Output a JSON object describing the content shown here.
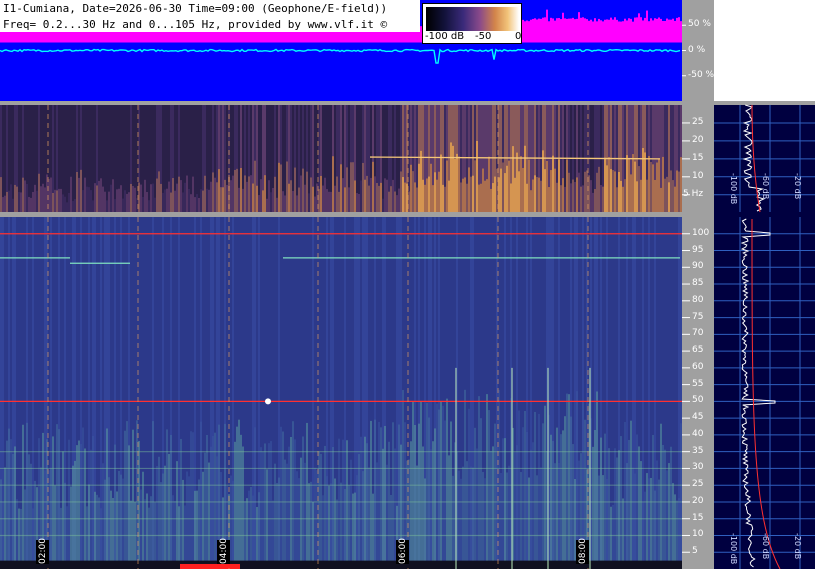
{
  "header": {
    "line1": "I1-Cumiana, Date=2026-06-30 Time=09:00 (Geophone/E-field))",
    "line2": "Freq= 0.2...30 Hz and 0...105 Hz, provided by www.vlf.it ©"
  },
  "colorscale": {
    "label_min": "-100 dB",
    "label_mid": "-50",
    "label_max": "0"
  },
  "colors": {
    "amplitude_bg": "#0000ff",
    "amplitude_envelope": "#ff00ff",
    "amplitude_trace": "#00ffff",
    "spectrum_panel_bg": "#000040",
    "spectrogram_bg": "#2c3a8a",
    "hum_line": "#ff3030",
    "cursor_line": "#e6a060",
    "axis_panel": "#a0a0a0"
  },
  "chart_data": [
    {
      "type": "line",
      "name": "amplitude-panel",
      "y_tick_labels": [
        "50 %",
        "0 %",
        "-50 %"
      ],
      "y_ticks": [
        50,
        0,
        -50
      ],
      "ylim": [
        -100,
        100
      ]
    },
    {
      "type": "heatmap",
      "name": "geophone-spectrogram",
      "y_tick_labels": [
        "25",
        "20",
        "15",
        "10",
        "5 Hz"
      ],
      "y_ticks": [
        25,
        20,
        15,
        10,
        5
      ],
      "ylim": [
        0.2,
        30
      ],
      "spectrum_db_labels": [
        "-100 dB",
        "-60 dB",
        "-20 dB"
      ]
    },
    {
      "type": "heatmap",
      "name": "efield-spectrogram",
      "y_tick_labels": [
        "100",
        "95",
        "90",
        "85",
        "80",
        "75",
        "70",
        "65",
        "60",
        "55",
        "50",
        "45",
        "40",
        "35",
        "30",
        "25",
        "20",
        "15",
        "10",
        "5"
      ],
      "y_ticks": [
        100,
        95,
        90,
        85,
        80,
        75,
        70,
        65,
        60,
        55,
        50,
        45,
        40,
        35,
        30,
        25,
        20,
        15,
        10,
        5
      ],
      "ylim": [
        0,
        105
      ],
      "hum_lines_hz": [
        50,
        100
      ],
      "spectrum_db_labels": [
        "-100 dB",
        "-60 dB",
        "-20 dB"
      ]
    }
  ],
  "time_axis": {
    "labels": [
      "02:00",
      "04:00",
      "06:00",
      "08:00"
    ]
  }
}
